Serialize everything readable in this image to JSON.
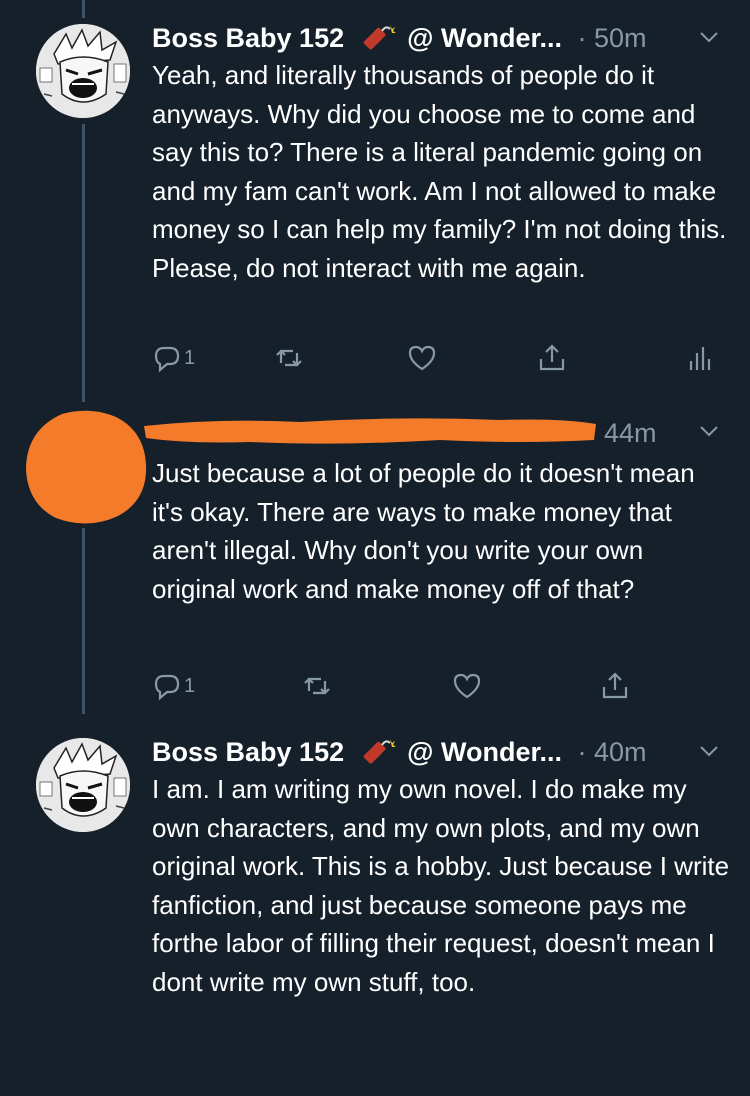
{
  "tweets": [
    {
      "name": "Boss Baby 152",
      "handle": "@ Wonder...",
      "time": "· 50m",
      "text": "Yeah, and literally thousands of people do it anyways. Why did you choose me to come and say this to? There is a literal pandemic going on and my fam can't work. Am I not allowed to make money so I can help my family? I'm not doing this. Please, do not interact with me again.",
      "reply_count": "1"
    },
    {
      "time": "44m",
      "text": "Just because a lot of people do it doesn't mean it's okay. There are ways to make money that aren't illegal. Why don't you write your own original work and make money off of that?",
      "reply_count": "1"
    },
    {
      "name": "Boss Baby 152",
      "handle": "@ Wonder...",
      "time": "· 40m",
      "text": "I am. I am writing my own novel. I do make my own characters, and my own plots, and my own original work. This is a hobby. Just because I write fanfiction, and just because someone pays me forthe labor of filling their request, doesn't mean I dont write my own stuff, too."
    }
  ],
  "icons": {
    "reply": "reply-icon",
    "retweet": "retweet-icon",
    "like": "heart-icon",
    "share": "share-icon",
    "analytics": "analytics-icon",
    "more": "chevron-down-icon",
    "emoji": "dynamite-icon"
  },
  "colors": {
    "background": "#15202b",
    "text": "#ffffff",
    "secondary": "#8899a6",
    "thread_line": "#3d5466",
    "redaction": "#f47b2a"
  }
}
